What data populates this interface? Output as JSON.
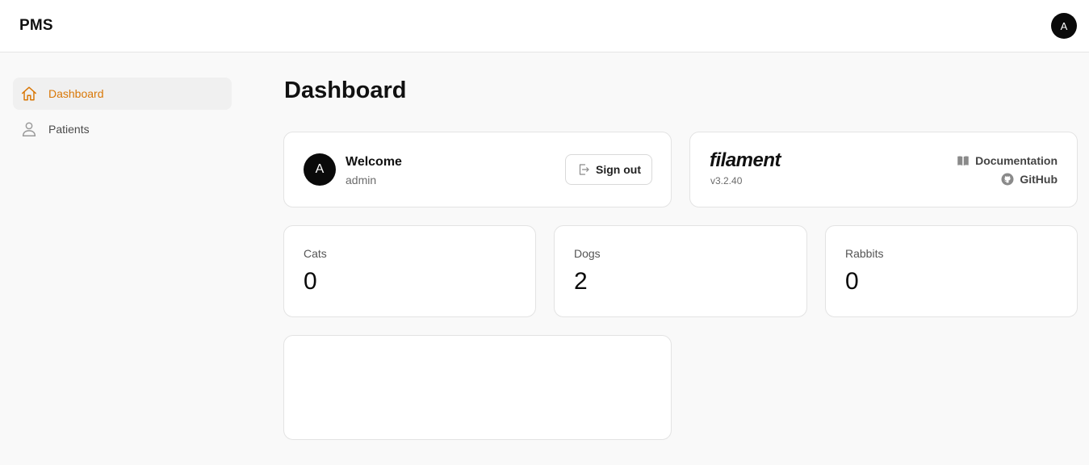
{
  "app": {
    "brand": "PMS",
    "user_initial": "A"
  },
  "sidebar": {
    "items": [
      {
        "label": "Dashboard",
        "icon": "home-icon",
        "active": true
      },
      {
        "label": "Patients",
        "icon": "user-icon",
        "active": false
      }
    ]
  },
  "page": {
    "title": "Dashboard"
  },
  "account_widget": {
    "avatar_initial": "A",
    "title": "Welcome",
    "username": "admin",
    "signout_label": "Sign out"
  },
  "filament_widget": {
    "logo": "filament",
    "version": "v3.2.40",
    "links": [
      {
        "label": "Documentation",
        "icon": "book-icon"
      },
      {
        "label": "GitHub",
        "icon": "github-icon"
      }
    ]
  },
  "stats": [
    {
      "label": "Cats",
      "value": "0"
    },
    {
      "label": "Dogs",
      "value": "2"
    },
    {
      "label": "Rabbits",
      "value": "0"
    }
  ],
  "colors": {
    "accent": "#d97706",
    "avatar_bg": "#0a0a0a"
  }
}
